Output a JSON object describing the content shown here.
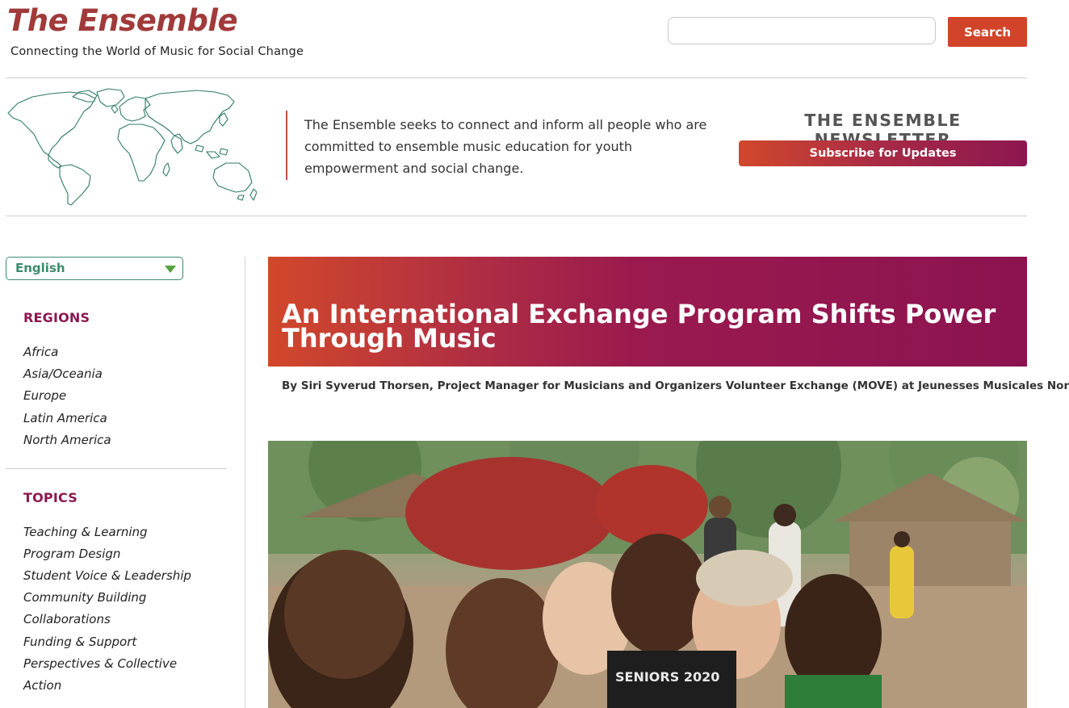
{
  "site": {
    "logo": "The Ensemble",
    "tagline": "Connecting the World of Music for Social Change"
  },
  "search": {
    "placeholder": "",
    "value": "",
    "button_label": "Search"
  },
  "intro": {
    "text": "The Ensemble seeks to connect and inform all people who are committed to ensemble music education for youth empowerment and social change."
  },
  "newsletter": {
    "title": "THE ENSEMBLE NEWSLETTER",
    "button_label": "Subscribe for Updates"
  },
  "sidebar": {
    "language": {
      "selected": "English"
    },
    "regions": {
      "heading": "REGIONS",
      "items": [
        "Africa",
        "Asia/Oceania",
        "Europe",
        "Latin America",
        "North America"
      ]
    },
    "topics": {
      "heading": "TOPICS",
      "items": [
        "Teaching & Learning",
        "Program Design",
        "Student Voice & Leadership",
        "Community Building",
        "Collaborations",
        "Funding & Support",
        "Perspectives & Collective",
        "Action"
      ]
    }
  },
  "article": {
    "title": "An International Exchange Program Shifts Power Through Music",
    "byline": "By Siri Syverud Thorsen, Project Manager for Musicians and Organizers Volunteer Exchange (MOVE) at Jeunesses Musicales Norway",
    "photo_shirt_text": "SENIORS 2020"
  },
  "colors": {
    "brand_red": "#a13a3a",
    "accent_orange": "#d1442a",
    "accent_magenta": "#8c1650",
    "accent_green": "#3b8c6e"
  },
  "icons": {
    "language_caret": "chevron-down-icon",
    "world_map": "world-map-icon"
  }
}
